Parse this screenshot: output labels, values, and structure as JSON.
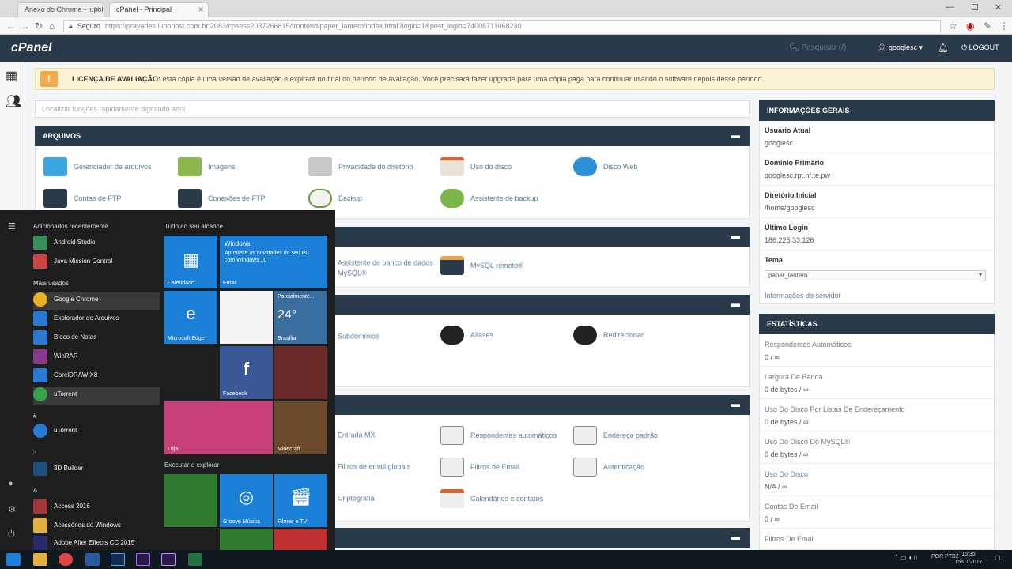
{
  "browser": {
    "tabs": [
      "Anexo do Chrome - lupoh",
      "cPanel - Principal"
    ],
    "address_secure": "Seguro",
    "url": "https://prayades.lupohost.com.br:2083/cpsess2037266815/frontend/paper_lantern/index.html?login=1&post_login=74008711068230"
  },
  "header": {
    "logo": "cPanel",
    "search_placeholder": "Pesquisar (/)",
    "username": "googlesc",
    "logout": "LOGOUT"
  },
  "banner": {
    "bold": "LICENÇA DE AVALIAÇÃO:",
    "text": "esta cópia é uma versão de avaliação e expirará no final do período de avaliação. Você precisará fazer upgrade para uma cópia paga para continuar usando o software depois desse período."
  },
  "search_functions_placeholder": "Localizar funções rapidamente digitando aqui",
  "sections": {
    "arquivos": {
      "title": "ARQUIVOS",
      "items": [
        "Gerenciador de arquivos",
        "Imagens",
        "Privacidade do diretório",
        "Uso do disco",
        "Disco Web",
        "Contas de FTP",
        "Conexões de FTP",
        "Backup",
        "Assistente de backup"
      ]
    },
    "bancos": {
      "items": [
        "Assistente de banco de dados MySQL®",
        "MySQL remoto®"
      ]
    },
    "dominios": {
      "items": [
        "Subdomínios",
        "Aliases",
        "Redirecionar"
      ]
    },
    "email": {
      "items": [
        "Entrada MX",
        "Respondentes automáticos",
        "Endereço padrão",
        "Filtros de email globais",
        "Filtros de Email",
        "Autenticação",
        "Criptografia",
        "Calendários e contatos"
      ]
    }
  },
  "sidebar": {
    "general_title": "INFORMAÇÕES GERAIS",
    "current_user_label": "Usuário Atual",
    "current_user": "googlesc",
    "primary_domain_label": "Domínio Primário",
    "primary_domain": "googlesc.rpt.hf.te.pw",
    "home_dir_label": "Diretório Inicial",
    "home_dir": "/home/googlesc",
    "last_login_label": "Último Login",
    "last_login": "186.225.33.126",
    "theme_label": "Tema",
    "theme_value": "paper_lantern",
    "server_info_link": "Informações do servidor",
    "stats_title": "ESTATÍSTICAS",
    "stats": [
      {
        "label": "Respondentes Automáticos",
        "value": "0 / ∞"
      },
      {
        "label": "Largura De Banda",
        "value": "0 de bytes / ∞"
      },
      {
        "label": "Uso Do Disco Por Listas De Endereçamento",
        "value": "0 de bytes / ∞"
      },
      {
        "label": "Uso Do Disco Do MySQL®",
        "value": "0 de bytes / ∞"
      },
      {
        "label": "Uso Do Disco",
        "value": "N/A / ∞"
      },
      {
        "label": "Contas De Email",
        "value": "0 / ∞"
      },
      {
        "label": "Filtros De Email",
        "value": ""
      }
    ]
  },
  "start_menu": {
    "recent_head": "Adicionados recentemente",
    "recent": [
      "Android Studio",
      "Java Mission Control"
    ],
    "most_used_head": "Mais usados",
    "most_used": [
      "Google Chrome",
      "Explorador de Arquivos",
      "Bloco de Notas",
      "WinRAR",
      "CorelDRAW X8",
      "uTorrent"
    ],
    "letter_hash": "#",
    "hash_items": [
      "uTorrent"
    ],
    "letter_3": "3",
    "three_items": [
      "3D Builder"
    ],
    "letter_a": "A",
    "a_items": [
      "Access 2016",
      "Acessórios do Windows",
      "Adobe After Effects CC 2015"
    ],
    "tiles_head": "Tudo ao seu alcance",
    "explore_head": "Executar e explorar",
    "tiles": {
      "calendar": "Calendário",
      "mail": "Email",
      "mail_title": "Windows",
      "mail_body": "Aproveite as novidades do seu PC com Windows 10",
      "edge": "Microsoft Edge",
      "weather_title": "Parcialmente...",
      "weather_temp": "24°",
      "weather_city": "Brasília",
      "facebook": "Facebook",
      "store": "Loja",
      "groove": "Groove Música",
      "films": "Filmes e TV",
      "minecraft": "Minecraft"
    }
  },
  "taskbar": {
    "lang": "POR PTB2",
    "time": "15:35",
    "date": "15/01/2017"
  }
}
